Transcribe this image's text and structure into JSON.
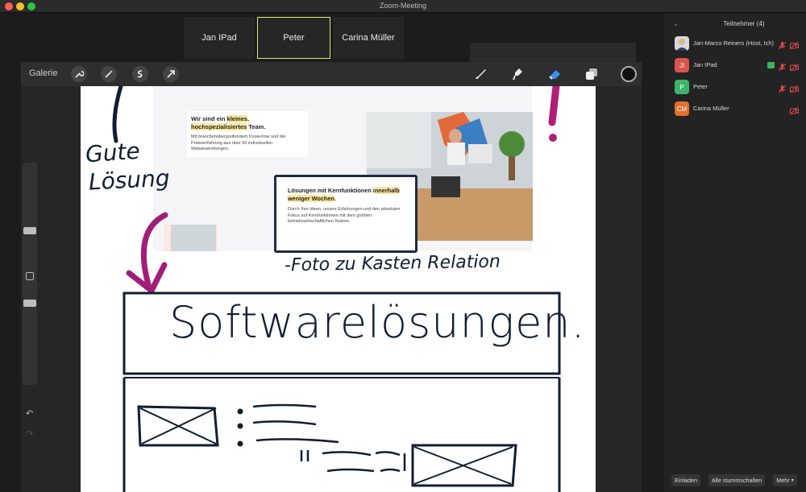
{
  "window": {
    "title": "Zoom-Meeting"
  },
  "thumbnails": [
    {
      "label": ""
    },
    {
      "label": "Jan IPad"
    },
    {
      "label": "Peter"
    },
    {
      "label": "Carina Müller"
    }
  ],
  "procreate": {
    "gallery_label": "Galerie",
    "left_tools": [
      "wrench-icon",
      "magic-wand-icon",
      "selection-icon",
      "transform-arrow-icon"
    ],
    "right_tools": [
      "brush-icon",
      "smudge-icon",
      "eraser-icon",
      "layers-icon"
    ],
    "active_color": "#111111"
  },
  "canvas": {
    "hero": {
      "title_part1": "Wir sind ein ",
      "title_highlight1": "kleines",
      "title_part2": ",",
      "title_highlight2": "hochspezialisiertes",
      "title_part3": " Team.",
      "description": "Mit branchenübergreifendem Know-how und der Praxiserfahrung aus über 50 individuellen Webanwendungen."
    },
    "box": {
      "title_part1": "Lösungen mit Kernfunktionen i",
      "title_highlight": "nnerhalb weniger Wochen",
      "title_part2": ".",
      "description": "Durch Ihre Ideen, unsere Erfahrungen und den absoluten Fokus auf Kernfunktionen mit dem größten betriebswirtschaftlichen Nutzen."
    },
    "handwriting": {
      "gute": "Gute",
      "losung": "Lösung",
      "foto": "-Foto zu Kasten Relation",
      "software": "Softwarelösungen."
    }
  },
  "participants_panel": {
    "title": "Teilnehmer (4)",
    "participants": [
      {
        "name": "Jan-Marco Reiners (Host, Ich)",
        "initials": "",
        "color": "#cfd6da"
      },
      {
        "name": "Jan IPad",
        "initials": "JI",
        "color": "#d9534f"
      },
      {
        "name": "Peter",
        "initials": "P",
        "color": "#3db56a"
      },
      {
        "name": "Carina Müller",
        "initials": "CM",
        "color": "#e2702a"
      }
    ],
    "invite_label": "Einladen",
    "mute_all_label": "Alle stummschalten",
    "more_label": "Mehr"
  }
}
